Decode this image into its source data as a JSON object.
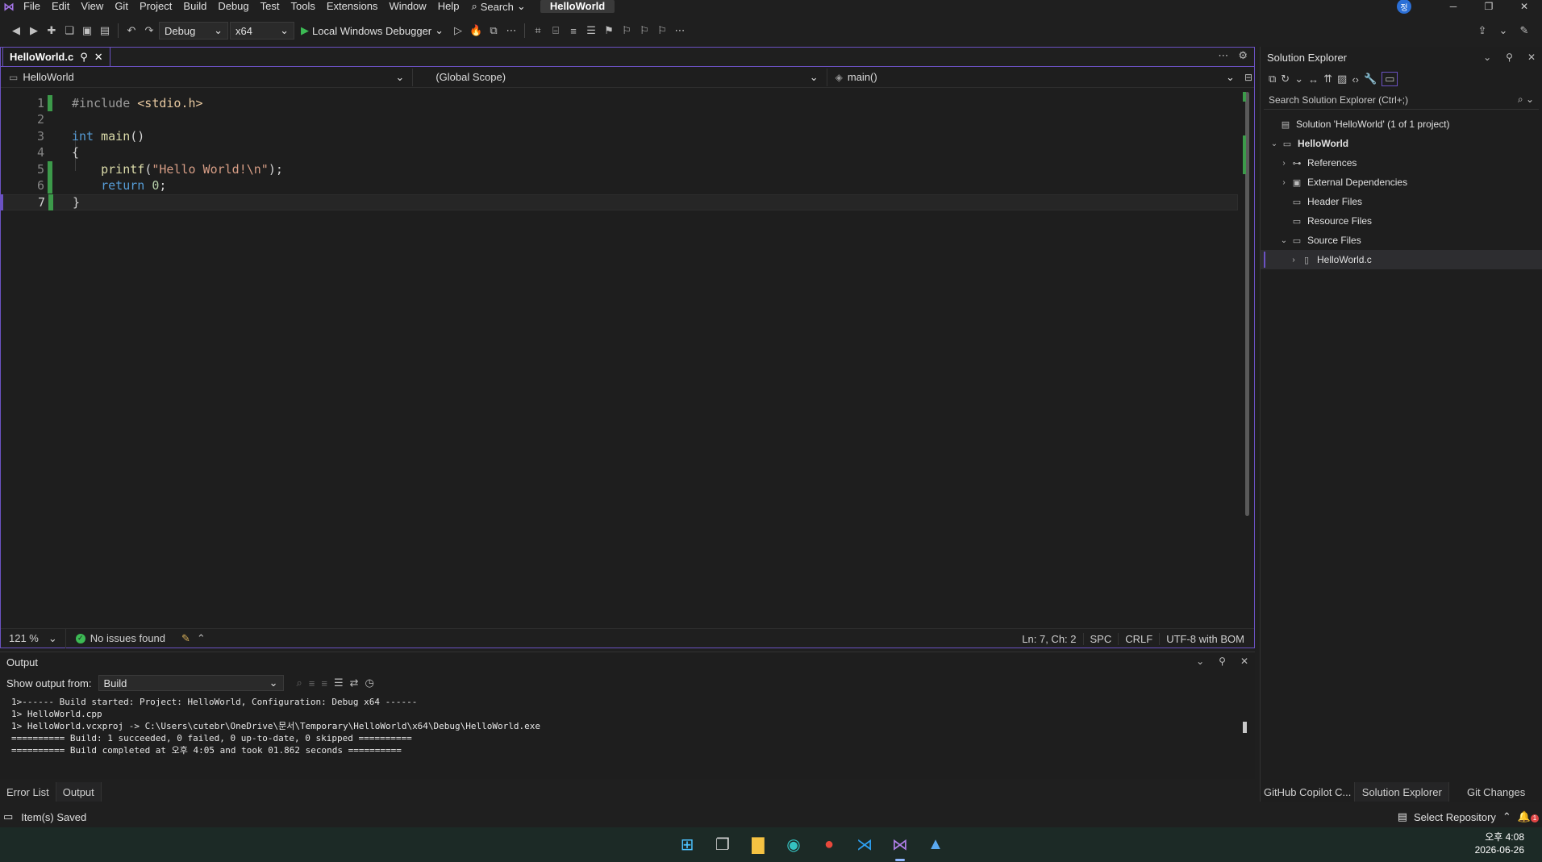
{
  "window": {
    "title": "HelloWorld",
    "avatar_initial": "정"
  },
  "menu": {
    "items": [
      "File",
      "Edit",
      "View",
      "Git",
      "Project",
      "Build",
      "Debug",
      "Test",
      "Tools",
      "Extensions",
      "Window",
      "Help"
    ],
    "search_label": "Search"
  },
  "toolbar": {
    "configuration": "Debug",
    "platform": "x64",
    "run_label": "Local Windows Debugger"
  },
  "editor": {
    "tab_label": "HelloWorld.c",
    "nav_project": "HelloWorld",
    "nav_scope": "(Global Scope)",
    "nav_member": "main()",
    "lines": [
      {
        "n": "1",
        "text": "#include <stdio.h>"
      },
      {
        "n": "2",
        "text": ""
      },
      {
        "n": "3",
        "text": "int main()"
      },
      {
        "n": "4",
        "text": "{"
      },
      {
        "n": "5",
        "text": "    printf(\"Hello World!\\n\");"
      },
      {
        "n": "6",
        "text": "    return 0;"
      },
      {
        "n": "7",
        "text": "}"
      }
    ],
    "zoom": "121 %",
    "issues": "No issues found",
    "position": "Ln: 7, Ch: 2",
    "whitespace": "SPC",
    "line_endings": "CRLF",
    "encoding": "UTF-8 with BOM"
  },
  "output": {
    "title": "Output",
    "show_from_label": "Show output from:",
    "source": "Build",
    "lines": [
      "1>------ Build started: Project: HelloWorld, Configuration: Debug x64 ------",
      "1>  HelloWorld.cpp",
      "1>  HelloWorld.vcxproj -> C:\\Users\\cutebr\\OneDrive\\문서\\Temporary\\HelloWorld\\x64\\Debug\\HelloWorld.exe",
      "========== Build: 1 succeeded, 0 failed, 0 up-to-date, 0 skipped ==========",
      "========== Build completed at 오후 4:05 and took 01.862 seconds =========="
    ]
  },
  "bottom_tabs": [
    "Error List",
    "Output"
  ],
  "solution_explorer": {
    "title": "Solution Explorer",
    "search_placeholder": "Search Solution Explorer (Ctrl+;)",
    "solution_label": "Solution 'HelloWorld'  (1 of 1 project)",
    "project": "HelloWorld",
    "nodes": {
      "references": "References",
      "external": "External Dependencies",
      "headers": "Header Files",
      "resources": "Resource Files",
      "sources": "Source Files",
      "file": "HelloWorld.c"
    },
    "bottom_tabs": [
      "GitHub Copilot C...",
      "Solution Explorer",
      "Git Changes"
    ]
  },
  "statusbar": {
    "message": "Item(s) Saved",
    "repo": "Select Repository",
    "notifications": "1"
  },
  "taskbar": {
    "time": "오후 4:08",
    "date": "2026-06-26"
  }
}
